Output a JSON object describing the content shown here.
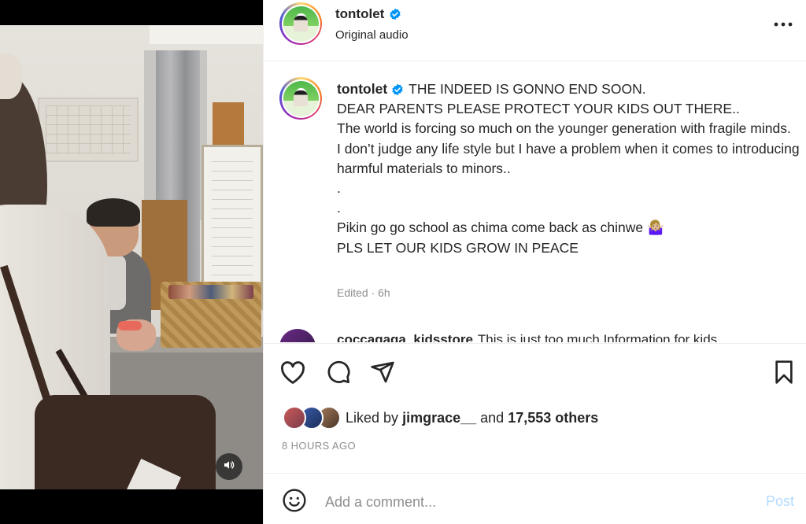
{
  "post": {
    "username": "tontolet",
    "audio": "Original audio",
    "caption_user": "tontolet",
    "caption": "THE INDEED IS GONNO END SOON.\nDEAR PARENTS PLEASE PROTECT YOUR KIDS OUT THERE..\nThe world is forcing so much on the younger generation with fragile minds.\nI don’t judge any life style but I have a problem when it comes to introducing harmful materials to minors..\n.\n.\nPikin go go school as chima come back as chinwe 🤷🏼‍♀️\nPLS LET OUR KIDS GROW IN PEACE",
    "edited_meta": "Edited · 6h"
  },
  "next_comment": {
    "username": "coccagaga_kidsstore",
    "text": "This is just too much Information for kids"
  },
  "likes": {
    "prefix": "Liked by",
    "user": "jimgrace__",
    "connector": "and",
    "count": "17,553 others"
  },
  "timestamp": "8 HOURS AGO",
  "comment_box": {
    "placeholder": "Add a comment...",
    "post_label": "Post"
  },
  "icons": {
    "more": "more-horizontal-icon",
    "verified": "verified-badge-icon",
    "like": "heart-icon",
    "comment": "comment-bubble-icon",
    "share": "send-paper-plane-icon",
    "save": "bookmark-icon",
    "emoji": "emoji-smiley-icon",
    "sound": "volume-icon"
  },
  "colors": {
    "verified_blue": "#0095f6",
    "post_disabled": "#b3dbff",
    "muted_text": "#8e8e8e"
  }
}
